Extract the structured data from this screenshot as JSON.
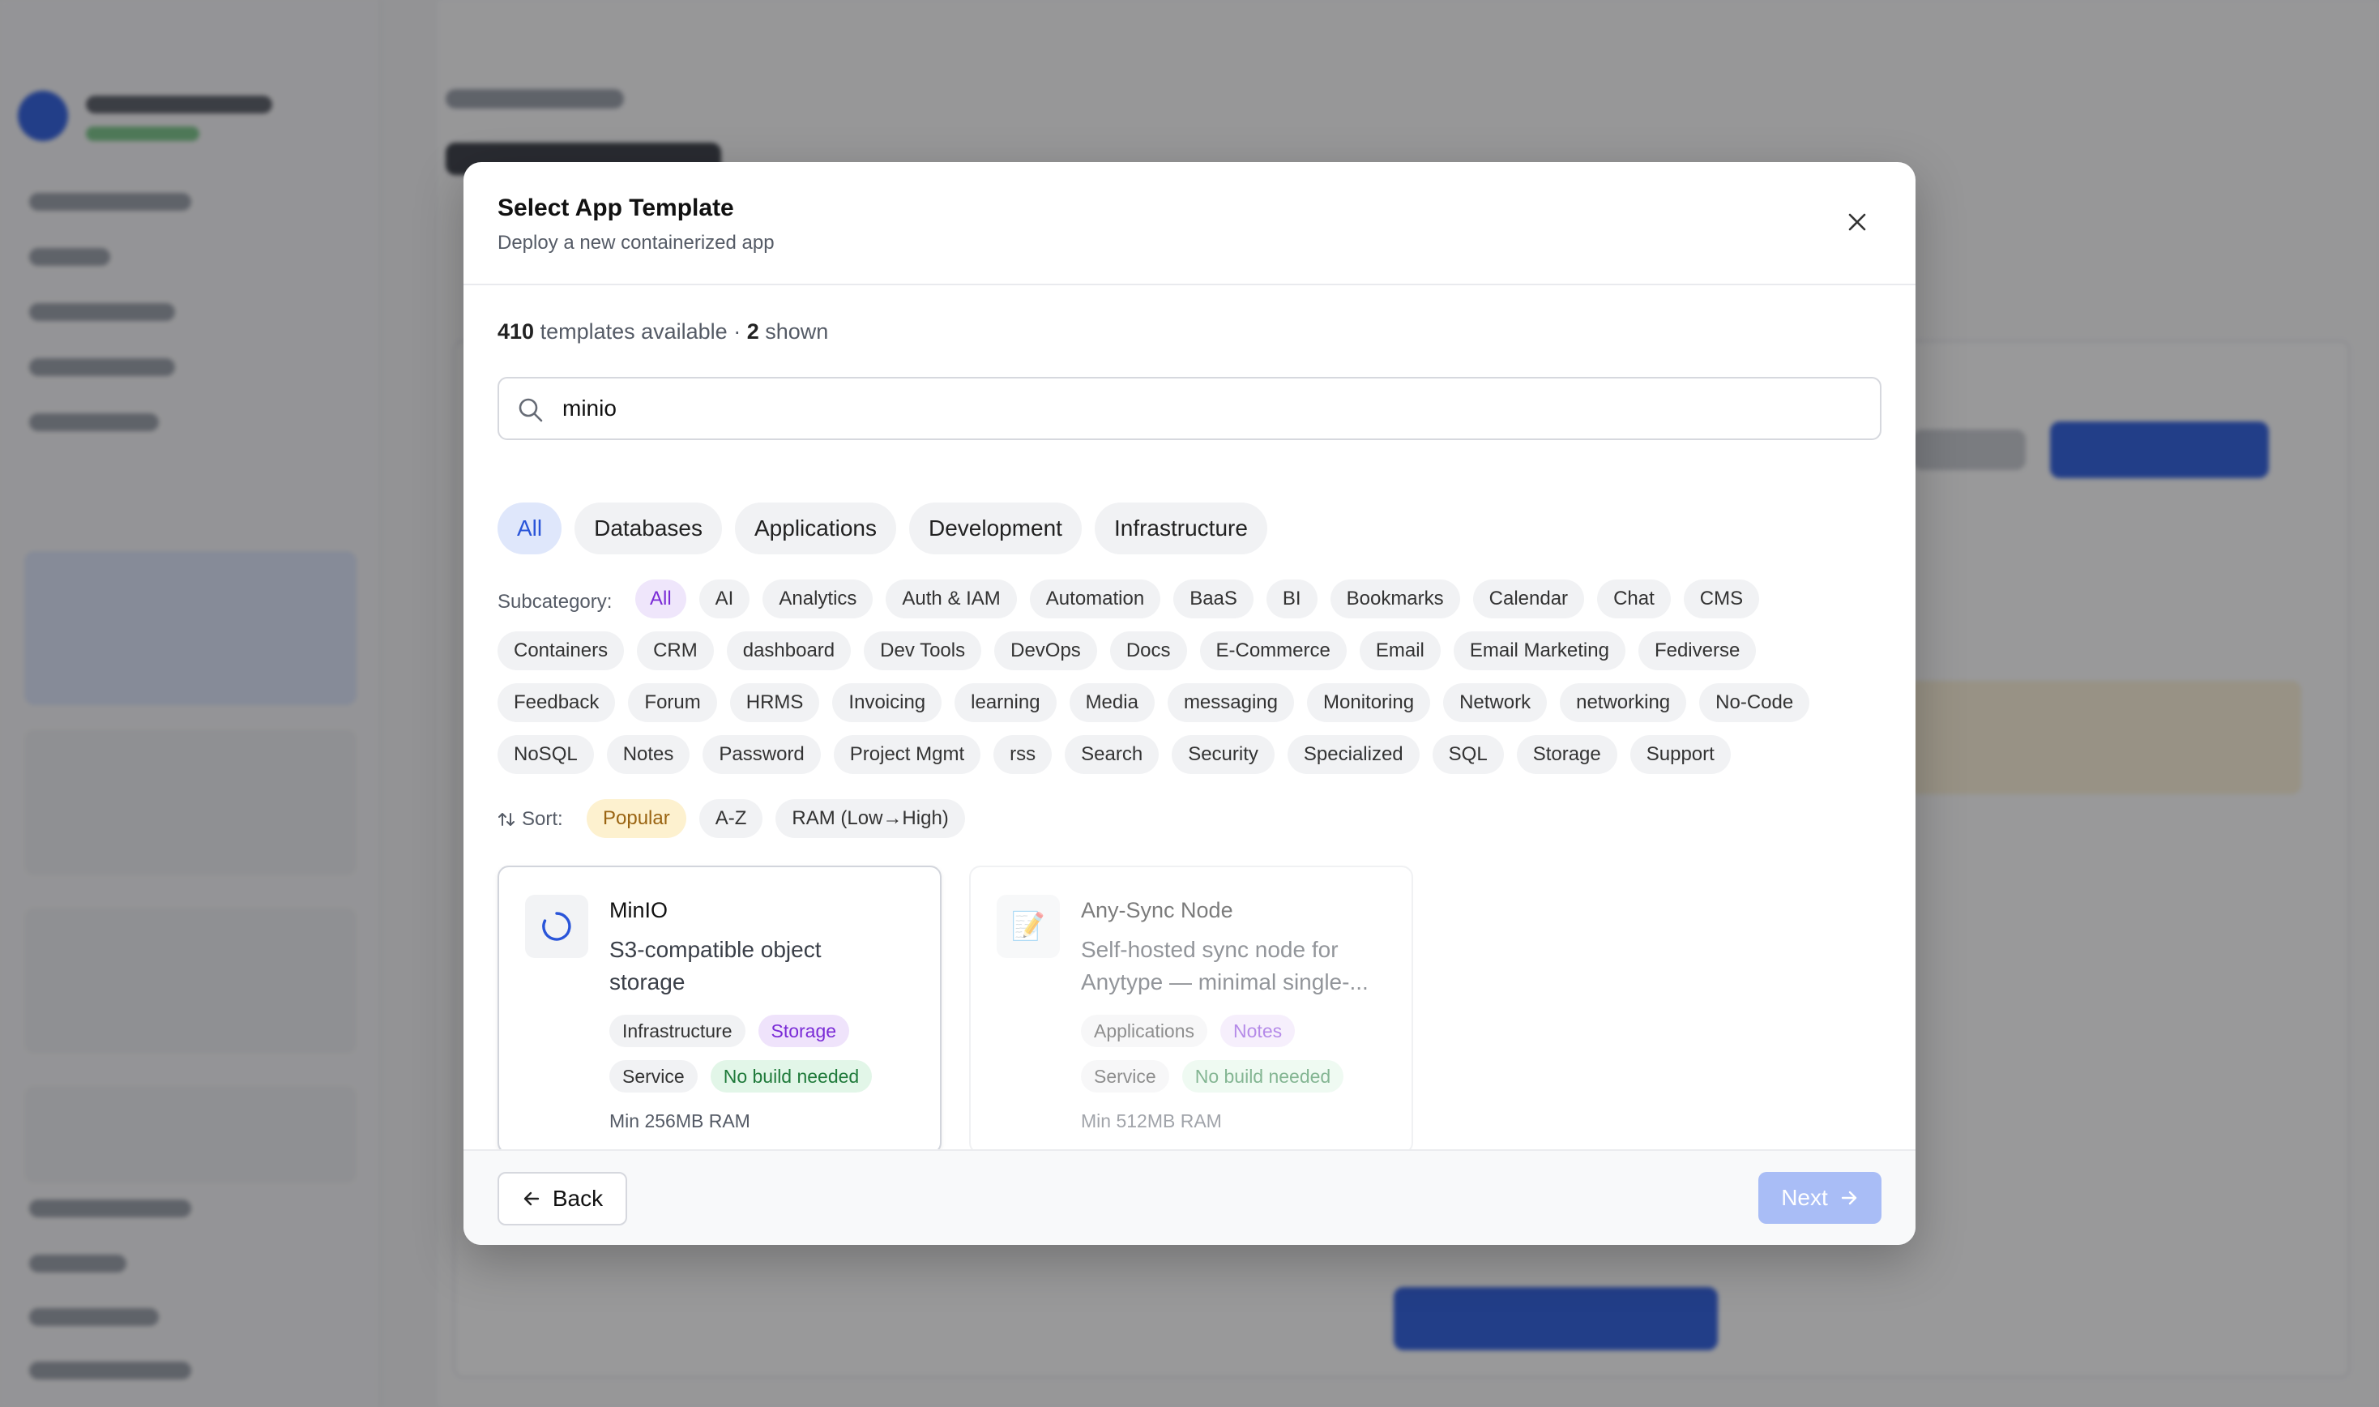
{
  "colors": {
    "accent": "#2a55d9",
    "overlay": "rgba(18,18,22,0.43)",
    "purple_chip": "#7a2bd6",
    "green_tag": "#1f7a3a",
    "sort_active": "#9a6412"
  },
  "modal": {
    "title": "Select App Template",
    "subtitle": "Deploy a new containerized app",
    "close_icon": "close-icon"
  },
  "counts": {
    "total": "410",
    "total_suffix": " templates available · ",
    "shown": "2",
    "shown_suffix": " shown"
  },
  "search": {
    "value": "minio",
    "icon": "search-icon"
  },
  "categories": [
    "All",
    "Databases",
    "Applications",
    "Development",
    "Infrastructure"
  ],
  "active_category": "All",
  "subcategory_label": "Subcategory:",
  "subcategories": [
    "All",
    "AI",
    "Analytics",
    "Auth & IAM",
    "Automation",
    "BaaS",
    "BI",
    "Bookmarks",
    "Calendar",
    "Chat",
    "CMS",
    "Containers",
    "CRM",
    "dashboard",
    "Dev Tools",
    "DevOps",
    "Docs",
    "E-Commerce",
    "Email",
    "Email Marketing",
    "Fediverse",
    "Feedback",
    "Forum",
    "HRMS",
    "Invoicing",
    "learning",
    "Media",
    "messaging",
    "Monitoring",
    "Network",
    "networking",
    "No-Code",
    "NoSQL",
    "Notes",
    "Password",
    "Project Mgmt",
    "rss",
    "Search",
    "Security",
    "Specialized",
    "SQL",
    "Storage",
    "Support"
  ],
  "active_subcategory": "All",
  "sort": {
    "label": "Sort:",
    "icon": "sort-arrows-icon",
    "options": [
      "Popular",
      "A-Z",
      "RAM (Low→High)"
    ],
    "active": "Popular"
  },
  "templates": [
    {
      "name": "MinIO",
      "icon": "loading-spinner-icon",
      "desc_line1": "S3-compatible object",
      "desc_line2": "storage",
      "category": "Infrastructure",
      "subcategory": "Storage",
      "type": "Service",
      "build": "No build needed",
      "ram": "Min 256MB RAM"
    },
    {
      "name": "Any-Sync Node",
      "icon": "memo-icon",
      "desc_line1": "Self-hosted sync node for",
      "desc_line2": "Anytype — minimal single-...",
      "category": "Applications",
      "subcategory": "Notes",
      "type": "Service",
      "build": "No build needed",
      "ram": "Min 512MB RAM"
    }
  ],
  "footer": {
    "back_label": "Back",
    "next_label": "Next"
  }
}
